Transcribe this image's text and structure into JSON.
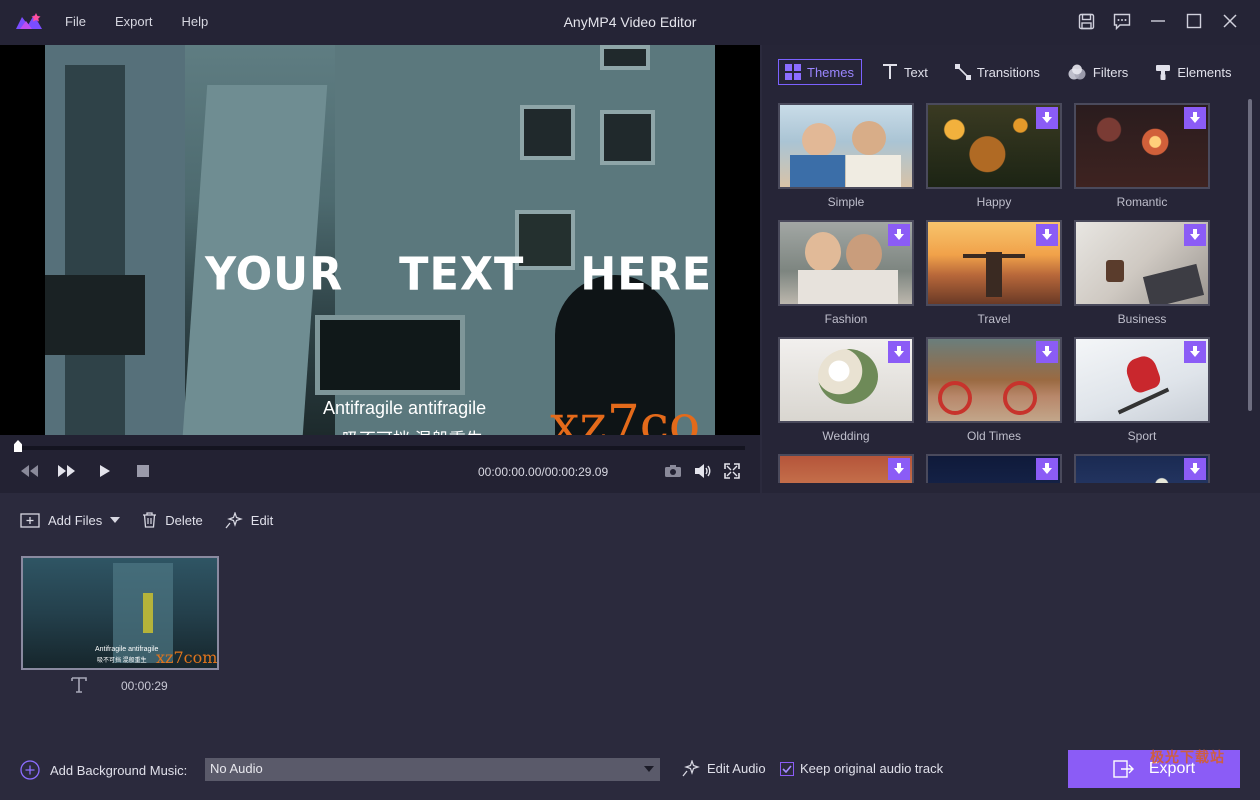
{
  "app": {
    "title": "AnyMP4 Video Editor"
  },
  "menu": [
    "File",
    "Export",
    "Help"
  ],
  "preview": {
    "overlay_text": "YOUR  TEXT  HERE",
    "subtitle_line1": "Antifragile antifragile",
    "subtitle_line2": "吸不可挡 混般重生",
    "watermark": "xz7co"
  },
  "player": {
    "timecode": "00:00:00.00/00:00:29.09",
    "progress": 0
  },
  "tabs": [
    {
      "label": "Themes",
      "icon": "themes-grid-icon",
      "active": true
    },
    {
      "label": "Text",
      "icon": "text-icon",
      "active": false
    },
    {
      "label": "Transitions",
      "icon": "transitions-icon",
      "active": false
    },
    {
      "label": "Filters",
      "icon": "filters-icon",
      "active": false
    },
    {
      "label": "Elements",
      "icon": "elements-icon",
      "active": false
    }
  ],
  "themes": [
    {
      "label": "Simple",
      "download": false
    },
    {
      "label": "Happy",
      "download": true
    },
    {
      "label": "Romantic",
      "download": true
    },
    {
      "label": "Fashion",
      "download": true
    },
    {
      "label": "Travel",
      "download": true
    },
    {
      "label": "Business",
      "download": true
    },
    {
      "label": "Wedding",
      "download": true
    },
    {
      "label": "Old Times",
      "download": true
    },
    {
      "label": "Sport",
      "download": true
    },
    {
      "label": "",
      "download": true
    },
    {
      "label": "",
      "download": true
    },
    {
      "label": "",
      "download": true
    }
  ],
  "toolbar": {
    "add_files": "Add Files",
    "delete": "Delete",
    "edit": "Edit"
  },
  "clip": {
    "duration": "00:00:29",
    "caption1": "Antifragile antifragile",
    "caption2": "吸不可挡 混般重生",
    "watermark": "xz7com"
  },
  "bottom": {
    "add_music_label": "Add Background Music:",
    "audio_value": "No Audio",
    "edit_audio": "Edit Audio",
    "keep_original": "Keep original audio track",
    "keep_checked": true,
    "export_label": "Export",
    "site_mark": "极光下载站"
  },
  "colors": {
    "accent": "#8b5cf6",
    "background": "#2b2a3d",
    "panel": "#262537"
  }
}
